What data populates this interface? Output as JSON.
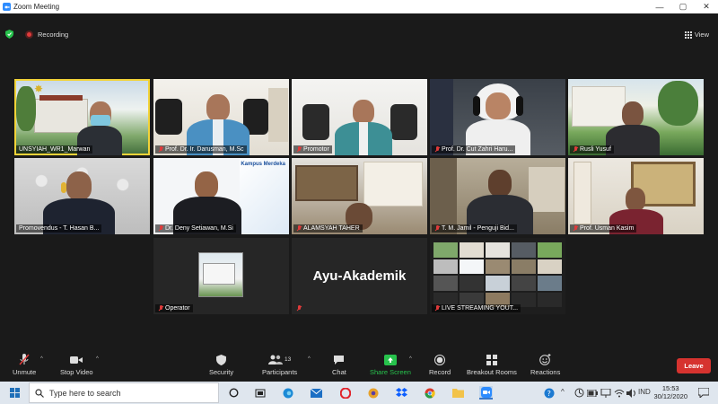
{
  "window": {
    "title": "Zoom Meeting",
    "controls": {
      "minimize": "—",
      "maximize": "▢",
      "close": "✕"
    }
  },
  "meeting": {
    "recording_label": "Recording",
    "view_label": "View",
    "speaker_highlight_color": "#f2d338"
  },
  "participants": [
    {
      "name": "UNSYIAH_WR1_Marwan",
      "muted": false,
      "active_speaker": true
    },
    {
      "name": "Prof. Dr. Ir. Darusman, M.Sc",
      "muted": true
    },
    {
      "name": "Promotor",
      "muted": true
    },
    {
      "name": "Prof. Dr. Cut Zahri Haru...",
      "muted": true
    },
    {
      "name": "Rusli Yusuf",
      "muted": true
    },
    {
      "name": "Promovendus - T. Hasan B...",
      "muted": false
    },
    {
      "name": "Dr. Deny Setiawan, M.Si",
      "muted": true,
      "banner": "Kampus Merdeka"
    },
    {
      "name": "ALAMSYAH TAHER",
      "muted": true
    },
    {
      "name": "T. M. Jamil - Penguji Bid...",
      "muted": true
    },
    {
      "name": "Prof. Usman Kasim",
      "muted": true
    },
    {
      "name": "Operator",
      "muted": true
    },
    {
      "name": "",
      "muted": true,
      "display_text": "Ayu-Akademik"
    },
    {
      "name": "LIVE STREAMING YOUT...",
      "muted": true
    }
  ],
  "toolbar": {
    "unmute": "Unmute",
    "stop_video": "Stop Video",
    "security": "Security",
    "participants": "Participants",
    "participants_count": "13",
    "chat": "Chat",
    "share_screen": "Share Screen",
    "record": "Record",
    "breakout_rooms": "Breakout Rooms",
    "reactions": "Reactions",
    "leave": "Leave",
    "share_color": "#27c24c",
    "leave_color": "#d6332f"
  },
  "taskbar": {
    "search_placeholder": "Type here to search",
    "language": "IND",
    "time": "15:53",
    "date": "30/12/2020"
  }
}
